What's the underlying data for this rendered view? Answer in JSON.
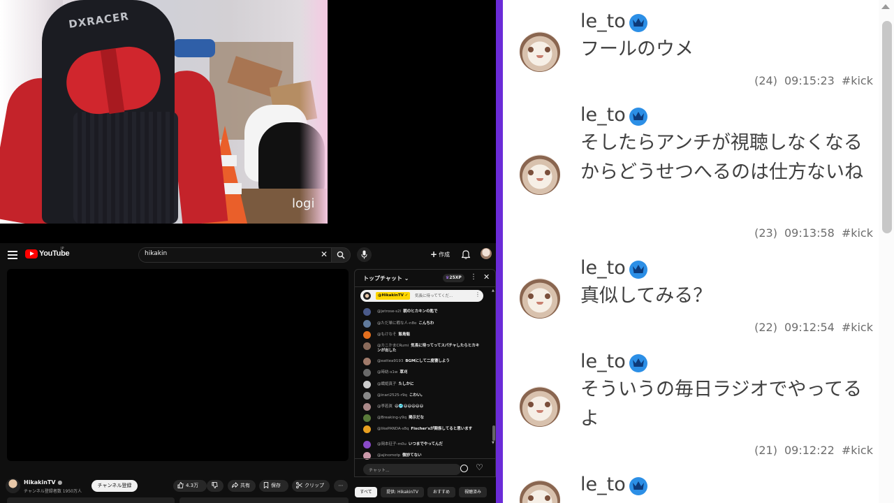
{
  "webcam": {
    "chair_brand": "DXRACER",
    "camera_brand": "logi"
  },
  "youtube": {
    "logo_text": "YouTube",
    "region": "JP",
    "search": {
      "value": "hikakin"
    },
    "create_label": "作成",
    "channel": {
      "name": "HikakinTV",
      "subscribers": "チャンネル登録者数 1950万人"
    },
    "subscribe_label": "チャンネル登録",
    "actions": {
      "likes": "4.3万",
      "share": "共有",
      "save": "保存",
      "clip": "クリップ"
    },
    "chips": [
      "すべて",
      "提供: HikakinTV",
      "おすすめ",
      "視聴済み"
    ]
  },
  "chat": {
    "title": "トップチャット",
    "xp": "25XP",
    "pinned": {
      "user": "@HikakinTV",
      "text": "気長に待っててくだ..."
    },
    "input_placeholder": "チャット...",
    "messages": [
      {
        "user": "@jetrose-s2l",
        "text": "朝のヒカキンの匙で",
        "color": "#4a5a8a"
      },
      {
        "user": "@ただ単に暇な人-n8o",
        "text": "こんちわ",
        "color": "#607a9c"
      },
      {
        "user": "@もけなそ",
        "text": "飯島魁",
        "color": "#e36f1e"
      },
      {
        "user": "@カニかまCRumi",
        "text": "気長に待ってってスパチャしたらヒカキンが出した",
        "color": "#8a6a5a"
      },
      {
        "user": "@eattea9193",
        "text": "BGMにして二度寝しよう",
        "color": "#a07a6a"
      },
      {
        "user": "@時紡-s1w",
        "text": "草刈",
        "color": "#6a6a6a"
      },
      {
        "user": "@織姫真子",
        "text": "たしかに",
        "color": "#ccc"
      },
      {
        "user": "@inari2525-r9q",
        "text": "こわい。",
        "color": "#888"
      },
      {
        "user": "@李若眞",
        "text": "😃🥶😃😃😃😃😃",
        "color": "#a88"
      },
      {
        "user": "@Breaking-y9q",
        "text": "掲示だな",
        "color": "#5a7a3a"
      },
      {
        "user": "@likePANDA-s8q",
        "text": "Fischer'sが関係してると思います",
        "color": "#e9a020"
      },
      {
        "user": "@岡本征子-m0u",
        "text": "いつまでやってんだ",
        "color": "#8a4ac8"
      },
      {
        "user": "@ajinomotp",
        "text": "微妙てない",
        "color": "#c9a"
      }
    ]
  },
  "comments": [
    {
      "name": "le_to",
      "message": "フールのウメ",
      "count": "(24)",
      "time": "09:15:23",
      "tag": "#kick"
    },
    {
      "name": "le_to",
      "message": "そしたらアンチが視聴しなくなるからどうせつへるのは仕方ないね",
      "count": "(23)",
      "time": "09:13:58",
      "tag": "#kick"
    },
    {
      "name": "le_to",
      "message": "真似してみる？",
      "count": "(22)",
      "time": "09:12:54",
      "tag": "#kick"
    },
    {
      "name": "le_to",
      "message": "そういうの毎日ラジオでやってるよ",
      "count": "(21)",
      "time": "09:12:22",
      "tag": "#kick"
    },
    {
      "name": "le_to",
      "message": "",
      "count": "",
      "time": "",
      "tag": ""
    }
  ],
  "colors": {
    "accent": "#6b2bd8",
    "badge": "#2c8fe6",
    "yt_red": "#ff0000"
  }
}
